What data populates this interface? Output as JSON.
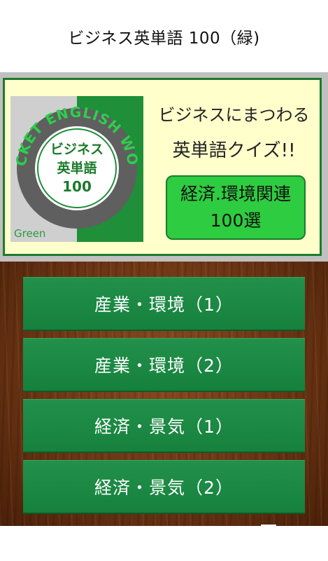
{
  "header": {
    "title": "ビジネス英単語 100（緑)"
  },
  "logo": {
    "ring_text": "POCKET ENGLISH WORD",
    "center_lines": [
      "ビジネス",
      "英単語",
      "100"
    ],
    "edition_label": "Green",
    "colors": {
      "green": "#1f8f3a",
      "gray": "#cfcfcf",
      "ring": "#5f5f5f"
    }
  },
  "banner": {
    "tagline_1": "ビジネスにまつわる",
    "tagline_2": "英単語クイズ!!",
    "subject_line_1": "経済.環境関連",
    "subject_line_2": "100選"
  },
  "menu": {
    "items": [
      {
        "label": "産業・環境（1）"
      },
      {
        "label": "産業・環境（2）"
      },
      {
        "label": "経済・景気（1）"
      },
      {
        "label": "経済・景気（2）"
      }
    ]
  },
  "colors": {
    "button_green": "#1a8a44",
    "banner_bg": "#ffffcc",
    "border_green": "#1e7a2c",
    "subject_green": "#2ecc40",
    "wood": "#6b3414"
  }
}
